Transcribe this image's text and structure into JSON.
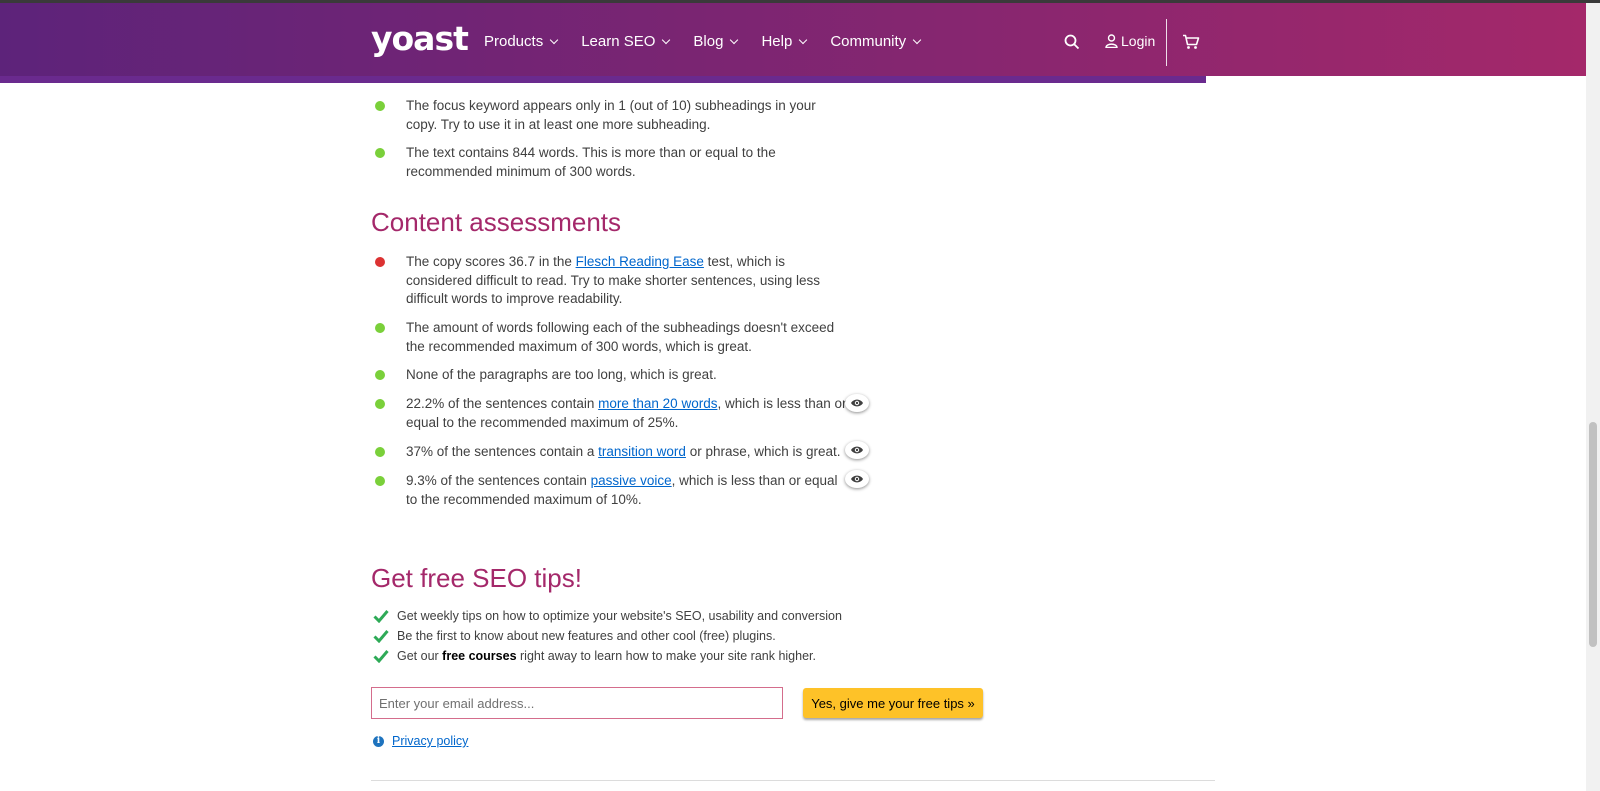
{
  "header": {
    "logo": "yoast",
    "nav": [
      "Products",
      "Learn SEO",
      "Blog",
      "Help",
      "Community"
    ],
    "login_label": "Login"
  },
  "seo_bullets": [
    {
      "status": "green",
      "text": "The focus keyword appears only in 1 (out of 10) subheadings in your copy. Try to use it in at least one more subheading."
    },
    {
      "status": "green",
      "text": "The text contains 844 words. This is more than or equal to the recommended minimum of 300 words."
    }
  ],
  "content_assessments": {
    "title": "Content assessments",
    "items": [
      {
        "status": "red",
        "before": "The copy scores 36.7 in the ",
        "link": "Flesch Reading Ease",
        "after": " test, which is considered difficult to read. Try to make shorter sentences, using less difficult words to improve readability.",
        "eye": false
      },
      {
        "status": "green",
        "before": "The amount of words following each of the subheadings doesn't exceed the recommended maximum of 300 words, which is great.",
        "link": "",
        "after": "",
        "eye": false
      },
      {
        "status": "green",
        "before": "None of the paragraphs are too long, which is great.",
        "link": "",
        "after": "",
        "eye": false
      },
      {
        "status": "green",
        "before": "22.2% of the sentences contain ",
        "link": "more than 20 words",
        "after": ", which is less than or equal to the recommended maximum of 25%.",
        "eye": true
      },
      {
        "status": "green",
        "before": "37% of the sentences contain a ",
        "link": "transition word",
        "after": " or phrase, which is great.",
        "eye": true
      },
      {
        "status": "green",
        "before": "9.3% of the sentences contain ",
        "link": "passive voice",
        "after": ", which is less than or equal to the recommended maximum of 10%.",
        "eye": true
      }
    ]
  },
  "newsletter": {
    "title": "Get free SEO tips!",
    "tips": [
      {
        "before": "Get weekly tips on how to optimize your website's SEO, usability and conversion",
        "bold": "",
        "after": ""
      },
      {
        "before": "Be the first to know about new features and other cool (free) plugins.",
        "bold": "",
        "after": ""
      },
      {
        "before": "Get our ",
        "bold": "free courses",
        "after": " right away to learn how to make your site rank higher."
      }
    ],
    "email_placeholder": "Enter your email address...",
    "cta_label": "Yes, give me your free tips »",
    "privacy_label": "Privacy policy"
  },
  "colors": {
    "accent": "#a4286a",
    "header_start": "#5d237a",
    "header_end": "#a4286a",
    "cta": "#fec228",
    "good": "#7ad03a",
    "bad": "#dc3232"
  }
}
